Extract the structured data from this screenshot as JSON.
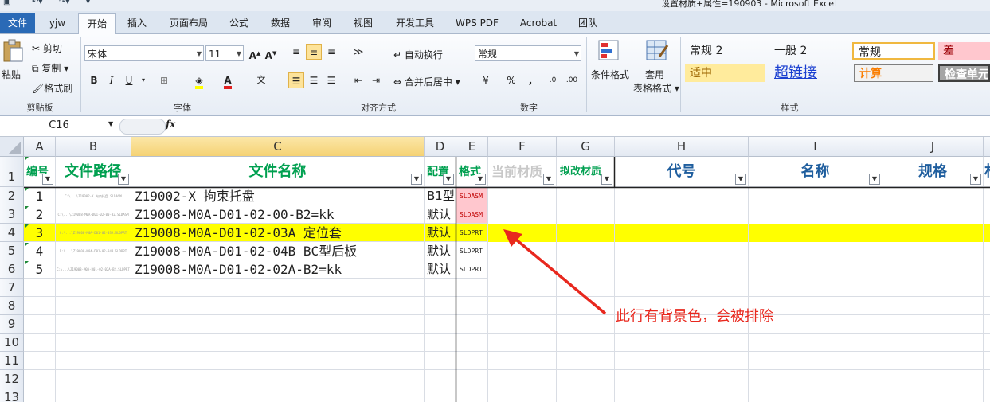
{
  "window": {
    "title": "设置材质+属性=190903  -  Microsoft Excel"
  },
  "tabs": [
    "文件",
    "yjw",
    "开始",
    "插入",
    "页面布局",
    "公式",
    "数据",
    "审阅",
    "视图",
    "开发工具",
    "WPS PDF",
    "Acrobat",
    "团队"
  ],
  "ribbon": {
    "clipboard": {
      "paste": "粘贴",
      "cut": "剪切",
      "copy": "复制",
      "format_painter": "格式刷",
      "label": "剪贴板"
    },
    "font": {
      "name": "宋体",
      "size": "11",
      "label": "字体"
    },
    "align": {
      "wrap": "自动换行",
      "merge": "合并后居中",
      "label": "对齐方式"
    },
    "number": {
      "format": "常规",
      "label": "数字"
    },
    "styles": {
      "cond_format": "条件格式",
      "table_format": "套用\n表格格式",
      "cells": [
        "常规 2",
        "一般 2",
        "常规",
        "差",
        "适中",
        "超链接",
        "计算",
        "检查单元"
      ],
      "label": "样式"
    }
  },
  "formula_bar": {
    "name_box": "C16",
    "fx": "fx",
    "value": ""
  },
  "columns": [
    "A",
    "B",
    "C",
    "D",
    "E",
    "F",
    "G",
    "H",
    "I",
    "J",
    "K"
  ],
  "rows": [
    "1",
    "2",
    "3",
    "4",
    "5",
    "6",
    "7",
    "8",
    "9",
    "10",
    "11",
    "12",
    "13"
  ],
  "header_row": {
    "A": "编号",
    "B": "文件路径",
    "C": "文件名称",
    "D": "配置",
    "E": "格式",
    "F": "当前材质",
    "G": "拟改材质",
    "H": "代号",
    "I": "名称",
    "J": "规格",
    "K": "材"
  },
  "data_rows": [
    {
      "A": "1",
      "B": "C:\\...\\Z19002-X 拘束托盘.SLDASM",
      "C": "Z19002-X 拘束托盘",
      "D": "B1型",
      "E": "SLDASM",
      "hl": false
    },
    {
      "A": "2",
      "B": "C:\\...\\Z19008-M0A-D01-02-00-B2.SLDASM",
      "C": "Z19008-M0A-D01-02-00-B2=kk",
      "D": "默认",
      "E": "SLDASM",
      "hl": false
    },
    {
      "A": "3",
      "B": "C:\\...\\Z19008-M0A-D01-02-03A.SLDPRT",
      "C": "Z19008-M0A-D01-02-03A 定位套",
      "D": "默认",
      "E": "SLDPRT",
      "hl": true
    },
    {
      "A": "4",
      "B": "D:\\...\\Z19008-M0A-D01-02-04B.SLDPRT",
      "C": "Z19008-M0A-D01-02-04B BC型后板",
      "D": "默认",
      "E": "SLDPRT",
      "hl": false
    },
    {
      "A": "5",
      "B": "C:\\...\\Z19008-M0A-D01-02-02A-B2.SLDPRT",
      "C": "Z19008-M0A-D01-02-02A-B2=kk",
      "D": "默认",
      "E": "SLDPRT",
      "hl": false
    }
  ],
  "annotation": {
    "text": "此行有背景色，会被排除"
  },
  "colors": {
    "header_green": "#00a050",
    "header_blue": "#1f5e9e",
    "highlight": "#ffff00",
    "pink": "#ffc7ce",
    "arrow": "#e8281e"
  }
}
